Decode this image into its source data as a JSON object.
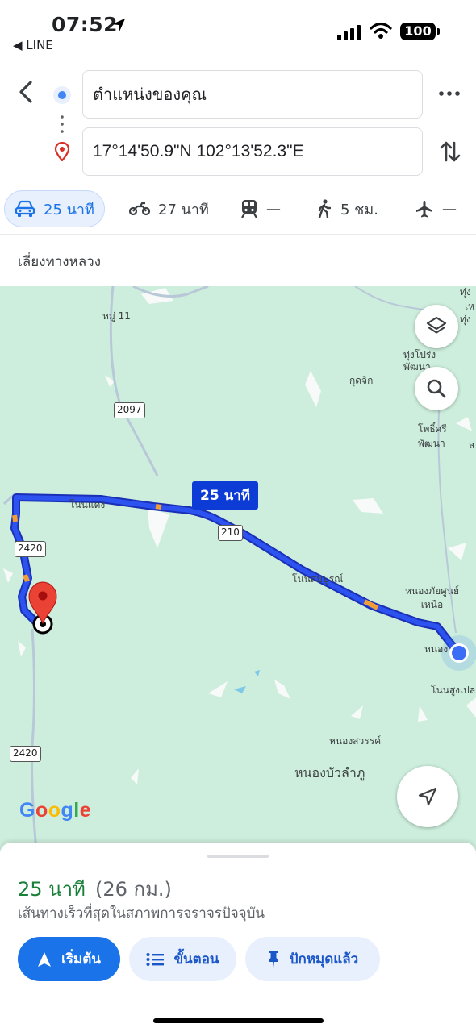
{
  "status_bar": {
    "time": "07:52",
    "back_app": "◀ LINE",
    "battery": "100"
  },
  "directions": {
    "origin": "ตำแหน่งของคุณ",
    "destination": "17°14'50.9\"N 102°13'52.3\"E"
  },
  "modes": [
    {
      "name": "drive",
      "label": "25 นาที",
      "icon": "car-icon",
      "active": true
    },
    {
      "name": "motorcycle",
      "label": "27 นาที",
      "icon": "motorcycle-icon"
    },
    {
      "name": "transit",
      "label": "—",
      "icon": "train-icon"
    },
    {
      "name": "walk",
      "label": "5 ชม.",
      "icon": "walking-icon"
    },
    {
      "name": "flight",
      "label": "—",
      "icon": "airplane-icon"
    }
  ],
  "options": {
    "avoid_label": "เลี่ยงทางหลวง"
  },
  "map": {
    "eta_tag": "25 นาที",
    "logo": "Google",
    "place_labels": {
      "moo11": "หมู่ 11",
      "kudchik": "กุดจิก",
      "thung_prong": "ทุ่งโปร่ง\nพัฒนา",
      "pho_si": "โพธิ์ศรี\nพัฒนา",
      "non_daeng": "โนนแดง",
      "non_somboon": "โนนสมบูรณ์",
      "nong_phai": "หนองภัยศูนย์\nเหนือ",
      "nong_edge": "หนอง",
      "non_sung": "โนนสูงเปล",
      "nong_sawan": "หนองสวรรค์",
      "nong_bua": "หนองบัวลำภู",
      "edge_top1": "ทุ่ง",
      "edge_top2": "เห",
      "edge_top3": "ทุ่ง",
      "edge_mid": "ส"
    },
    "road_shields": {
      "r2097": "2097",
      "r210": "210",
      "r2420a": "2420",
      "r2420b": "2420"
    },
    "colors": {
      "background": "#cdeedc",
      "route": "#1a3fd8",
      "traffic": "#f29d38",
      "destination_pin": "#ea4335"
    }
  },
  "summary": {
    "duration": "25 นาที",
    "distance": "(26 กม.)",
    "description": "เส้นทางเร็วที่สุดในสภาพการจราจรปัจจุบัน"
  },
  "actions": {
    "start": "เริ่มต้น",
    "steps": "ขั้นตอน",
    "pinned": "ปักหมุดแล้ว"
  }
}
